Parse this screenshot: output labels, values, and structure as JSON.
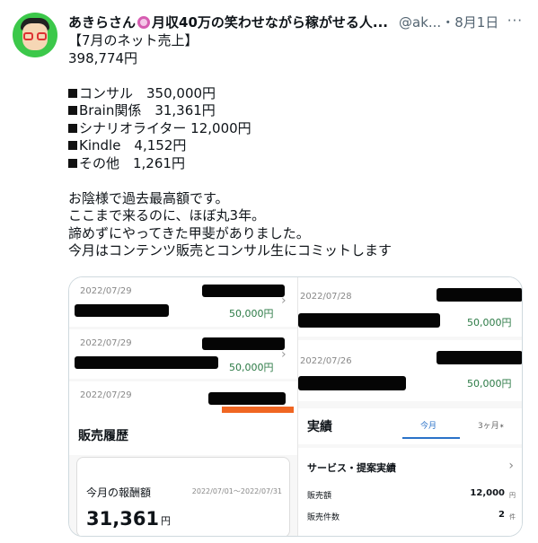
{
  "tweet": {
    "display_name": "あきらさん",
    "name_rest": "月収40万の笑わせながら稼がせる人...",
    "handle": "@ak...",
    "dot": "・",
    "date": "8月1日",
    "more": "···",
    "lines": [
      "【7月のネット売上】",
      "398,774円",
      "",
      "コンサル　350,000円",
      "Brain関係　31,361円",
      "シナリオライター 12,000円",
      "Kindle　4,152円",
      "その他　1,261円",
      "",
      "お陰様で過去最高額です。",
      "ここまで来るのに、ほぼ丸3年。",
      "諦めずにやってきた甲斐がありました。",
      "今月はコンテンツ販売とコンサル生にコミットします"
    ]
  },
  "left_panel": {
    "rows": [
      {
        "date": "2022/07/29",
        "amount": "50,000円"
      },
      {
        "date": "2022/07/29",
        "amount": "50,000円"
      },
      {
        "date": "2022/07/29"
      }
    ],
    "chevron": "›",
    "section_title": "販売履歴",
    "earnings_label": "今月の報酬額",
    "earnings_range": "2022/07/01〜2022/07/31",
    "earnings_value": "31,361",
    "earnings_unit": "円",
    "accent_color": "#f06622"
  },
  "right_panel": {
    "rows": [
      {
        "date": "2022/07/28",
        "amount": "50,000円"
      },
      {
        "date": "2022/07/26",
        "amount": "50,000円"
      }
    ],
    "section_title": "実績",
    "tabs": [
      "今月",
      "3ヶ月"
    ],
    "tab_suffix": "✶",
    "service_title": "サービス・提案実績",
    "chevron": "›",
    "stats": [
      {
        "label": "販売額",
        "value": "12,000",
        "unit": "円"
      },
      {
        "label": "販売件数",
        "value": "2",
        "unit": "件"
      }
    ],
    "accent_color": "#2a72c8"
  }
}
